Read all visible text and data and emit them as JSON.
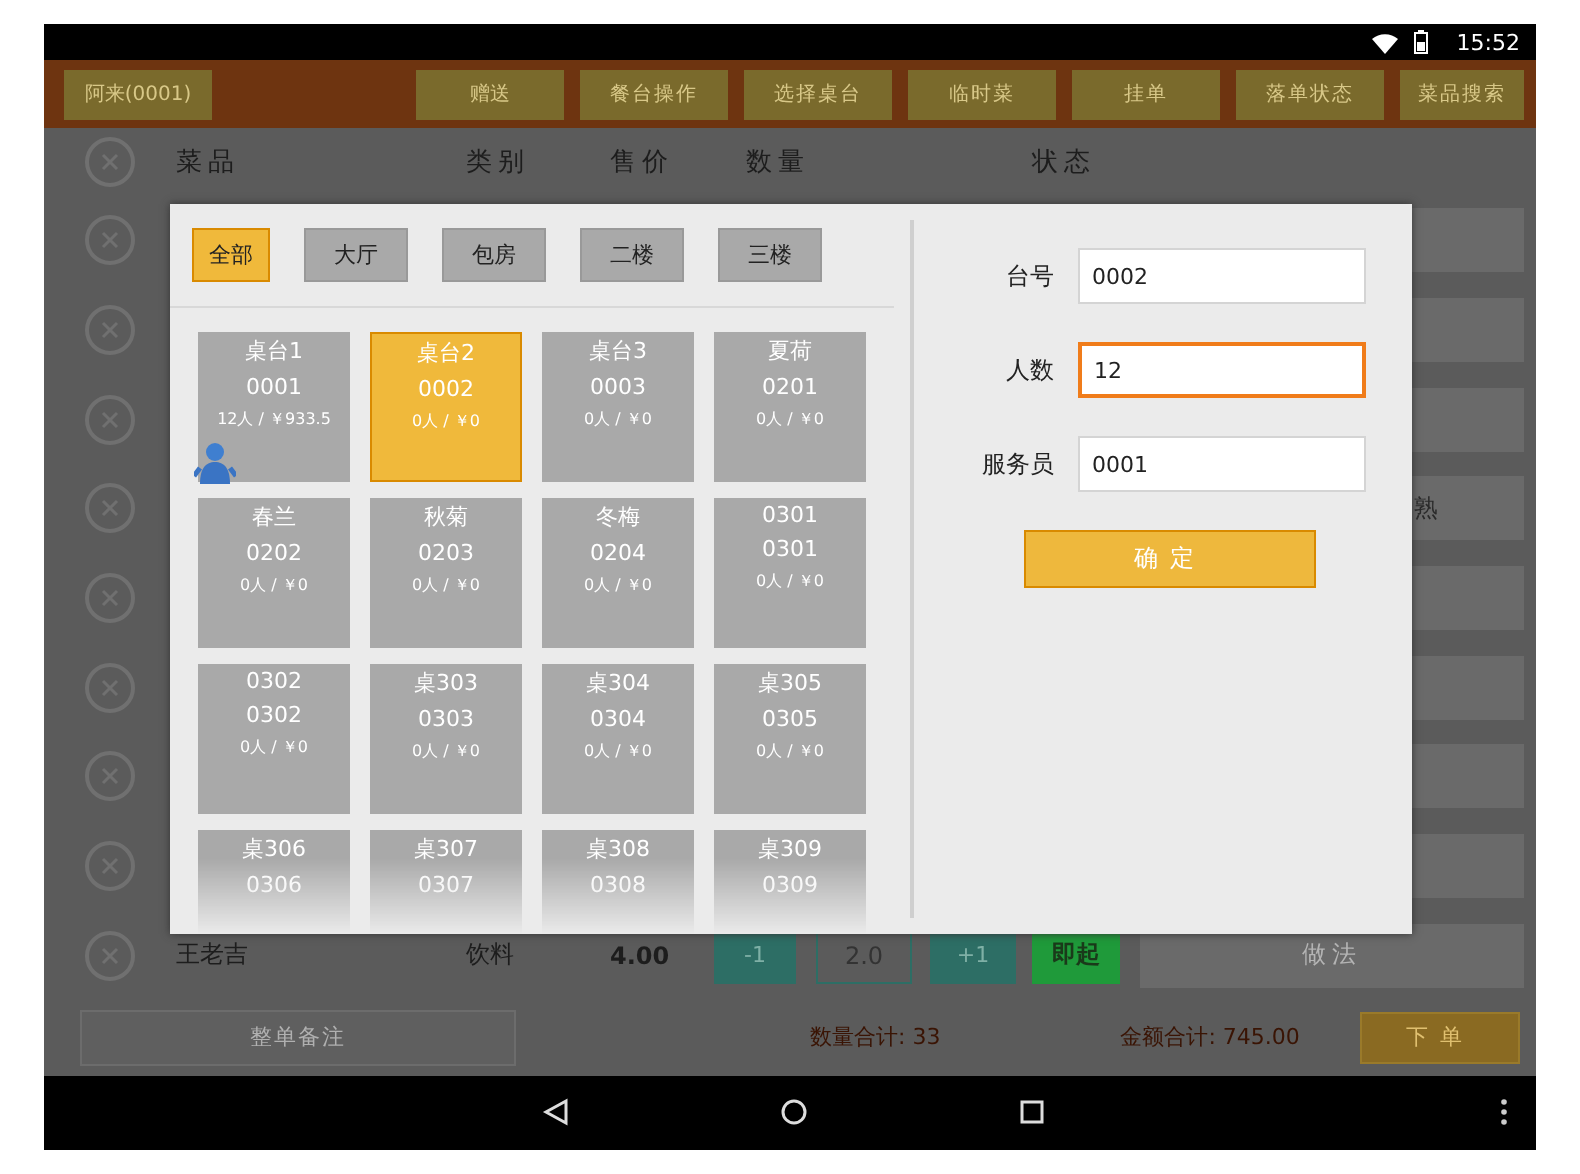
{
  "status_bar": {
    "time": "15:52"
  },
  "toolbar": {
    "waiter": "阿来(0001)",
    "buttons": [
      "赠送",
      "餐台操作",
      "选择桌台",
      "临时菜",
      "挂单",
      "落单状态",
      "菜品搜索"
    ]
  },
  "order_table": {
    "columns": [
      "菜品",
      "类别",
      "售价",
      "数量",
      "状态"
    ],
    "rows": [
      {
        "kind": "covered"
      },
      {
        "kind": "covered"
      },
      {
        "kind": "covered"
      },
      {
        "kind": "covered",
        "note": "熟"
      },
      {
        "kind": "covered"
      },
      {
        "kind": "covered"
      },
      {
        "kind": "covered"
      },
      {
        "kind": "covered"
      },
      {
        "kind": "full",
        "name": "王老吉",
        "category": "饮料",
        "price": "4.00",
        "minus": "-1",
        "quantity": "2.0",
        "plus": "+1",
        "status": "即起",
        "note": "做法"
      }
    ]
  },
  "footer": {
    "remark_button": "整单备注",
    "quantity_total": "数量合计: 33",
    "amount_total": "金额合计: 745.00",
    "submit_button": "下单"
  },
  "dialog": {
    "areas": [
      {
        "label": "全部",
        "selected": true
      },
      {
        "label": "大厅",
        "selected": false
      },
      {
        "label": "包房",
        "selected": false
      },
      {
        "label": "二楼",
        "selected": false
      },
      {
        "label": "三楼",
        "selected": false
      }
    ],
    "tables": [
      {
        "name": "桌台1",
        "code": "0001",
        "info": "12人 / ￥933.5",
        "selected": false,
        "occupied": true
      },
      {
        "name": "桌台2",
        "code": "0002",
        "info": "0人 / ￥0",
        "selected": true,
        "occupied": false
      },
      {
        "name": "桌台3",
        "code": "0003",
        "info": "0人 / ￥0",
        "selected": false,
        "occupied": false
      },
      {
        "name": "夏荷",
        "code": "0201",
        "info": "0人 / ￥0",
        "selected": false,
        "occupied": false
      },
      {
        "name": "春兰",
        "code": "0202",
        "info": "0人 / ￥0",
        "selected": false,
        "occupied": false
      },
      {
        "name": "秋菊",
        "code": "0203",
        "info": "0人 / ￥0",
        "selected": false,
        "occupied": false
      },
      {
        "name": "冬梅",
        "code": "0204",
        "info": "0人 / ￥0",
        "selected": false,
        "occupied": false
      },
      {
        "name": "0301",
        "code": "0301",
        "info": "0人 / ￥0",
        "selected": false,
        "occupied": false
      },
      {
        "name": "0302",
        "code": "0302",
        "info": "0人 / ￥0",
        "selected": false,
        "occupied": false
      },
      {
        "name": "桌303",
        "code": "0303",
        "info": "0人 / ￥0",
        "selected": false,
        "occupied": false
      },
      {
        "name": "桌304",
        "code": "0304",
        "info": "0人 / ￥0",
        "selected": false,
        "occupied": false
      },
      {
        "name": "桌305",
        "code": "0305",
        "info": "0人 / ￥0",
        "selected": false,
        "occupied": false
      },
      {
        "name": "桌306",
        "code": "0306",
        "selected": false,
        "occupied": false
      },
      {
        "name": "桌307",
        "code": "0307",
        "selected": false,
        "occupied": false
      },
      {
        "name": "桌308",
        "code": "0308",
        "selected": false,
        "occupied": false
      },
      {
        "name": "桌309",
        "code": "0309",
        "selected": false,
        "occupied": false
      }
    ],
    "fields": [
      {
        "label": "台号",
        "value": "0002",
        "focused": false
      },
      {
        "label": "人数",
        "value": "12",
        "focused": true
      },
      {
        "label": "服务员",
        "value": "0001",
        "focused": false
      }
    ],
    "confirm_button": "确定"
  }
}
